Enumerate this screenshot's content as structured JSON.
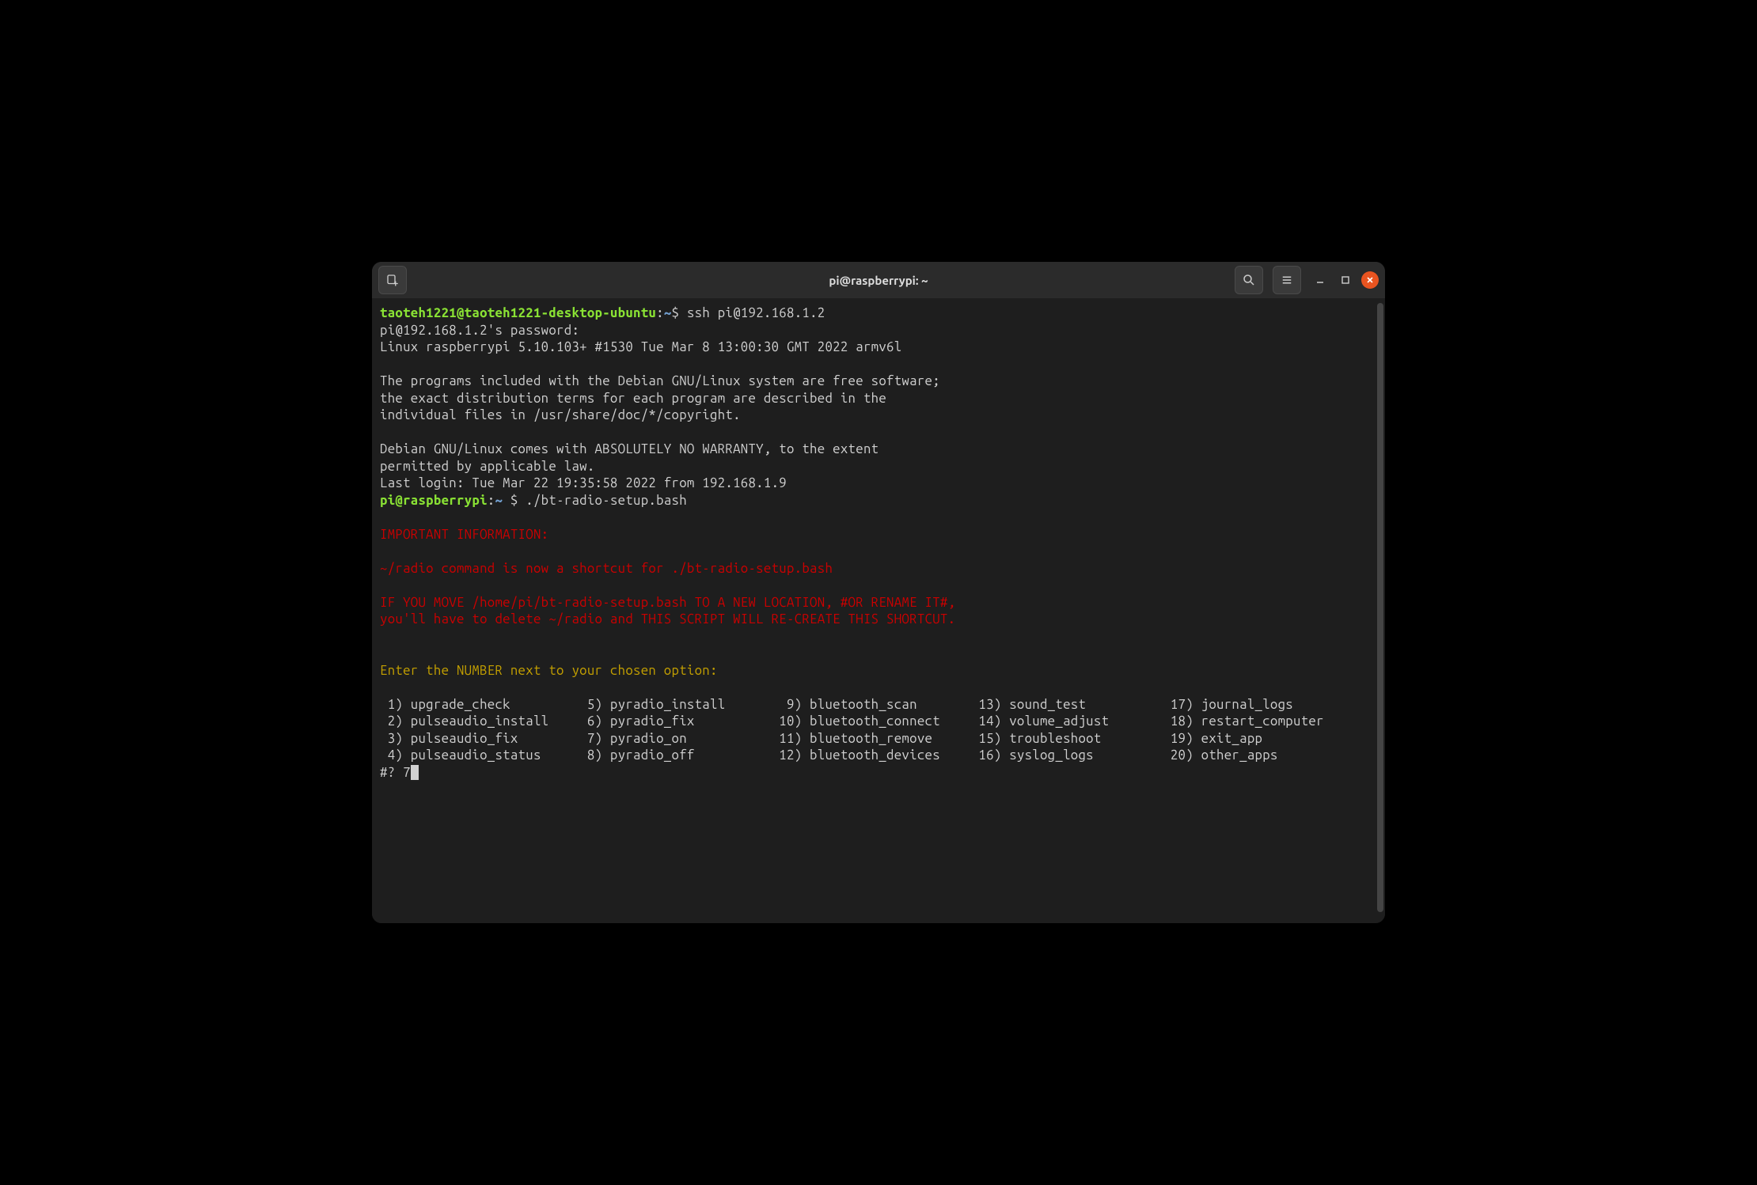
{
  "window": {
    "title": "pi@raspberrypi: ~"
  },
  "prompt1": {
    "userhost": "taoteh1221@taoteh1221-desktop-ubuntu",
    "sep": ":",
    "path": "~",
    "dollar": "$",
    "command": "ssh pi@192.168.1.2"
  },
  "lines": {
    "pwprompt": "pi@192.168.1.2's password:",
    "linux": "Linux raspberrypi 5.10.103+ #1530 Tue Mar 8 13:00:30 GMT 2022 armv6l",
    "blank": "",
    "motd1": "The programs included with the Debian GNU/Linux system are free software;",
    "motd2": "the exact distribution terms for each program are described in the",
    "motd3": "individual files in /usr/share/doc/*/copyright.",
    "motd4": "Debian GNU/Linux comes with ABSOLUTELY NO WARRANTY, to the extent",
    "motd5": "permitted by applicable law.",
    "lastlogin": "Last login: Tue Mar 22 19:35:58 2022 from 192.168.1.9"
  },
  "prompt2": {
    "userhost": "pi@raspberrypi",
    "sep": ":",
    "path": "~ ",
    "dollar": "$",
    "command": "./bt-radio-setup.bash"
  },
  "red": {
    "header": "IMPORTANT INFORMATION:",
    "l1": "~/radio command is now a shortcut for ./bt-radio-setup.bash",
    "l2": "IF YOU MOVE /home/pi/bt-radio-setup.bash TO A NEW LOCATION, #OR RENAME IT#,",
    "l3": "you'll have to delete ~/radio and THIS SCRIPT WILL RE-CREATE THIS SHORTCUT."
  },
  "yellow": {
    "prompt": "Enter the NUMBER next to your chosen option:"
  },
  "menu": {
    "row1": " 1) upgrade_check          5) pyradio_install        9) bluetooth_scan        13) sound_test           17) journal_logs",
    "row2": " 2) pulseaudio_install     6) pyradio_fix           10) bluetooth_connect     14) volume_adjust        18) restart_computer",
    "row3": " 3) pulseaudio_fix         7) pyradio_on            11) bluetooth_remove      15) troubleshoot         19) exit_app",
    "row4": " 4) pulseaudio_status      8) pyradio_off           12) bluetooth_devices     16) syslog_logs          20) other_apps"
  },
  "input": {
    "prompt": "#? ",
    "value": "7"
  },
  "menu_options": [
    {
      "num": 1,
      "label": "upgrade_check"
    },
    {
      "num": 2,
      "label": "pulseaudio_install"
    },
    {
      "num": 3,
      "label": "pulseaudio_fix"
    },
    {
      "num": 4,
      "label": "pulseaudio_status"
    },
    {
      "num": 5,
      "label": "pyradio_install"
    },
    {
      "num": 6,
      "label": "pyradio_fix"
    },
    {
      "num": 7,
      "label": "pyradio_on"
    },
    {
      "num": 8,
      "label": "pyradio_off"
    },
    {
      "num": 9,
      "label": "bluetooth_scan"
    },
    {
      "num": 10,
      "label": "bluetooth_connect"
    },
    {
      "num": 11,
      "label": "bluetooth_remove"
    },
    {
      "num": 12,
      "label": "bluetooth_devices"
    },
    {
      "num": 13,
      "label": "sound_test"
    },
    {
      "num": 14,
      "label": "volume_adjust"
    },
    {
      "num": 15,
      "label": "troubleshoot"
    },
    {
      "num": 16,
      "label": "syslog_logs"
    },
    {
      "num": 17,
      "label": "journal_logs"
    },
    {
      "num": 18,
      "label": "restart_computer"
    },
    {
      "num": 19,
      "label": "exit_app"
    },
    {
      "num": 20,
      "label": "other_apps"
    }
  ]
}
